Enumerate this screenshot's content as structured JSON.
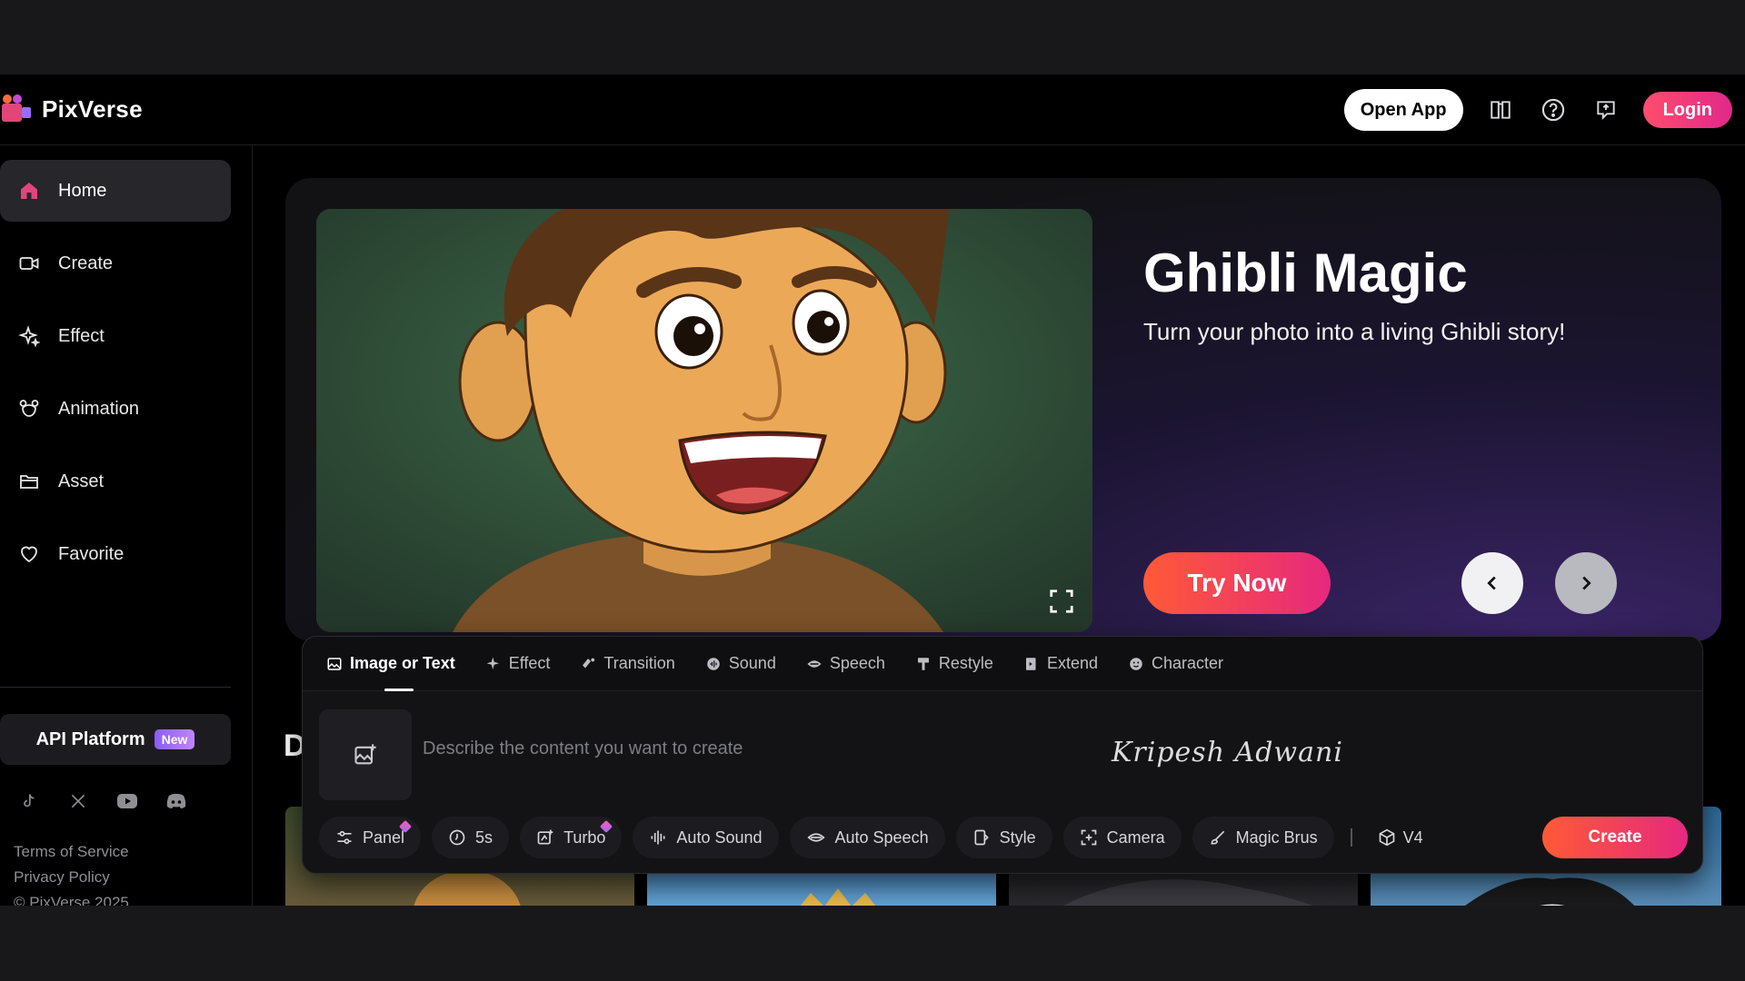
{
  "brand": {
    "name": "PixVerse"
  },
  "header": {
    "open_app": "Open App",
    "login": "Login",
    "icons": [
      "book-icon",
      "help-icon",
      "feedback-icon"
    ]
  },
  "sidebar": {
    "items": [
      {
        "label": "Home",
        "icon": "home-icon",
        "active": true
      },
      {
        "label": "Create",
        "icon": "video-camera-icon"
      },
      {
        "label": "Effect",
        "icon": "sparkle-icon"
      },
      {
        "label": "Animation",
        "icon": "mouse-ears-icon"
      },
      {
        "label": "Asset",
        "icon": "folder-icon"
      },
      {
        "label": "Favorite",
        "icon": "heart-icon"
      }
    ],
    "api_platform": "API Platform",
    "api_badge": "New",
    "socials": [
      "tiktok-icon",
      "x-icon",
      "youtube-icon",
      "discord-icon"
    ],
    "footer": {
      "terms": "Terms of Service",
      "privacy": "Privacy Policy",
      "copyright": "© PixVerse 2025"
    }
  },
  "hero": {
    "title": "Ghibli Magic",
    "subtitle": "Turn your photo into a living Ghibli story!",
    "cta": "Try Now"
  },
  "section": {
    "heading_partial": "D"
  },
  "composer": {
    "tabs": [
      {
        "label": "Image or Text",
        "icon": "image-icon",
        "active": true
      },
      {
        "label": "Effect",
        "icon": "sparkle-icon"
      },
      {
        "label": "Transition",
        "icon": "transition-icon"
      },
      {
        "label": "Sound",
        "icon": "sound-icon"
      },
      {
        "label": "Speech",
        "icon": "speech-icon"
      },
      {
        "label": "Restyle",
        "icon": "paint-roller-icon"
      },
      {
        "label": "Extend",
        "icon": "extend-icon"
      },
      {
        "label": "Character",
        "icon": "character-icon"
      }
    ],
    "placeholder": "Describe the content you want to create",
    "signature": "Kripesh Adwani",
    "toolbar": {
      "panel": "Panel",
      "duration": "5s",
      "turbo": "Turbo",
      "auto_sound": "Auto Sound",
      "auto_speech": "Auto Speech",
      "style": "Style",
      "camera": "Camera",
      "magic_brush": "Magic Brus",
      "model": "V4"
    },
    "create": "Create"
  },
  "colors": {
    "accent_gradient_start": "#ff5a36",
    "accent_gradient_end": "#e6287e",
    "login_start": "#ff4d6d",
    "badge_purple": "#8b5cf6",
    "background": "#000000"
  }
}
